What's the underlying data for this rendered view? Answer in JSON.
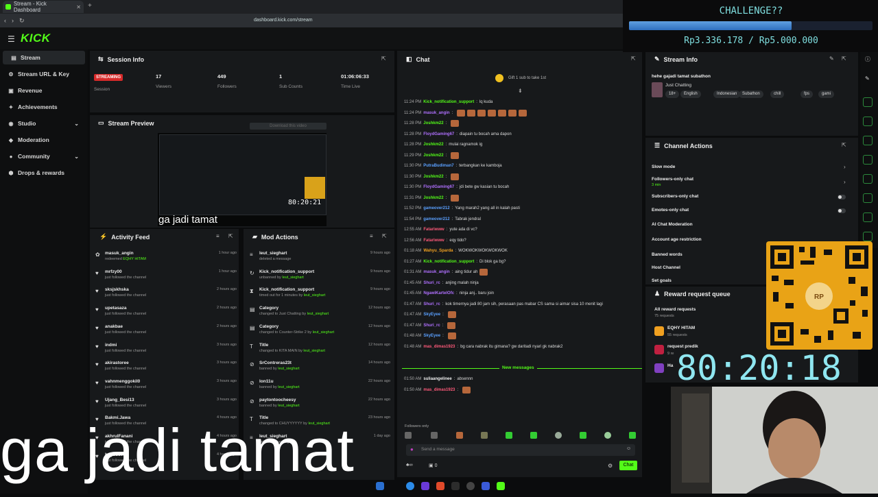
{
  "browser": {
    "tab_title": "Stream - Kick Dashboard",
    "url": "dashboard.kick.com/stream"
  },
  "header": {
    "logo": "KICK"
  },
  "sidebar": {
    "items": [
      {
        "label": "Stream"
      },
      {
        "label": "Stream URL & Key"
      },
      {
        "label": "Revenue"
      },
      {
        "label": "Achievements"
      },
      {
        "label": "Studio"
      },
      {
        "label": "Moderation"
      },
      {
        "label": "Community"
      },
      {
        "label": "Drops & rewards"
      }
    ]
  },
  "session": {
    "title": "Session Info",
    "badge": "STREAMING",
    "stats": [
      {
        "value": "",
        "label": "Session"
      },
      {
        "value": "17",
        "label": "Viewers"
      },
      {
        "value": "449",
        "label": "Followers"
      },
      {
        "value": "1",
        "label": "Sub Counts"
      },
      {
        "value": "01:06:06:33",
        "label": "Time Live"
      }
    ]
  },
  "preview": {
    "title": "Stream Preview",
    "download": "Download this video",
    "caption": "ga jadi tamat",
    "timer": "80:20:21"
  },
  "activity": {
    "title": "Activity Feed",
    "rows": [
      {
        "name": "masuk_angin",
        "sub": "redeemed ",
        "highlight": "EQHY HITAM",
        "time": "1 hour ago"
      },
      {
        "name": "mrfzy00",
        "sub": "just followed the channel",
        "highlight": "",
        "time": "1 hour ago"
      },
      {
        "name": "sksjskhska",
        "sub": "just followed the channel",
        "highlight": "",
        "time": "2 hours ago"
      },
      {
        "name": "upetasaza",
        "sub": "just followed the channel",
        "highlight": "",
        "time": "2 hours ago"
      },
      {
        "name": "anakbae",
        "sub": "just followed the channel",
        "highlight": "",
        "time": "2 hours ago"
      },
      {
        "name": "indmi",
        "sub": "just followed the channel",
        "highlight": "",
        "time": "3 hours ago"
      },
      {
        "name": "akirastoree",
        "sub": "just followed the channel",
        "highlight": "",
        "time": "3 hours ago"
      },
      {
        "name": "vahnmenggokil0",
        "sub": "just followed the channel",
        "highlight": "",
        "time": "3 hours ago"
      },
      {
        "name": "Ujang_Besi13",
        "sub": "just followed the channel",
        "highlight": "",
        "time": "3 hours ago"
      },
      {
        "name": "Bakmi.Jawa",
        "sub": "just followed the channel",
        "highlight": "",
        "time": "4 hours ago"
      },
      {
        "name": "akhrulFanani",
        "sub": "just followed the channel",
        "highlight": "",
        "time": "4 hours ago"
      },
      {
        "name": "boyo367",
        "sub": "just followed the channel",
        "highlight": "",
        "time": "4 hours ago"
      }
    ]
  },
  "mod": {
    "title": "Mod Actions",
    "rows": [
      {
        "icon": "≡",
        "name": "leut_sieghart",
        "sub": "deleted a message",
        "by": "",
        "time": "9 hours ago"
      },
      {
        "icon": "↻",
        "name": "Kick_notification_support",
        "sub": "unbanned by ",
        "by": "leut_sieghart",
        "time": "9 hours ago"
      },
      {
        "icon": "⧗",
        "name": "Kick_notification_support",
        "sub": "timed out for 1 minutes by ",
        "by": "leut_sieghart",
        "time": "9 hours ago"
      },
      {
        "icon": "▤",
        "name": "Category",
        "sub": "changed to Just Chatting by ",
        "by": "leut_sieghart",
        "time": "12 hours ago"
      },
      {
        "icon": "▤",
        "name": "Category",
        "sub": "changed to Counter-Strike 2 by ",
        "by": "leut_sieghart",
        "time": "12 hours ago"
      },
      {
        "icon": "T",
        "name": "Title",
        "sub": "changed to KITA MAIN by ",
        "by": "leut_sieghart",
        "time": "12 hours ago"
      },
      {
        "icon": "⊘",
        "name": "SrContreras23t",
        "sub": "banned by ",
        "by": "leut_sieghart",
        "time": "14 hours ago"
      },
      {
        "icon": "⊘",
        "name": "lon11u",
        "sub": "banned by ",
        "by": "leut_sieghart",
        "time": "22 hours ago"
      },
      {
        "icon": "⊘",
        "name": "paytontoocheesy",
        "sub": "banned by ",
        "by": "leut_sieghart",
        "time": "22 hours ago"
      },
      {
        "icon": "T",
        "name": "Title",
        "sub": "changed to CHUYYYYYY by ",
        "by": "leut_sieghart",
        "time": "23 hours ago"
      },
      {
        "icon": "≡",
        "name": "leut_sieghart",
        "sub": "deleted a message",
        "by": "",
        "time": "1 day ago"
      }
    ]
  },
  "chat": {
    "title": "Chat",
    "gift": "Gift 1 sub to take 1st",
    "new_messages": "New messages",
    "followers_only": "Followers only",
    "placeholder": "Send a message",
    "send": "Chat",
    "viewer_count": "0",
    "lines": [
      {
        "t": "11:24 PM",
        "u": "Kick_notification_support",
        "c": "#53fc18",
        "m": "lq kuda",
        "emotes": 0
      },
      {
        "t": "11:24 PM",
        "u": "masuk_angin",
        "c": "#b070ff",
        "m": "",
        "emotes": 7
      },
      {
        "t": "11:28 PM",
        "u": "Joshkm22",
        "c": "#53fc18",
        "m": "",
        "emotes": 1
      },
      {
        "t": "11:28 PM",
        "u": "FloydGaming67",
        "c": "#b070ff",
        "m": "diapain tu bocah ama dapon",
        "emotes": 0
      },
      {
        "t": "11:28 PM",
        "u": "Joshkm22",
        "c": "#53fc18",
        "m": "mulai ragnamok ig",
        "emotes": 0
      },
      {
        "t": "11:29 PM",
        "u": "Joshkm22",
        "c": "#53fc18",
        "m": "",
        "emotes": 1
      },
      {
        "t": "11:30 PM",
        "u": "PutraBudiman7",
        "c": "#5aa0ff",
        "m": "terbangkan ke kamboja",
        "emotes": 0
      },
      {
        "t": "11:30 PM",
        "u": "Joshkm22",
        "c": "#53fc18",
        "m": "",
        "emotes": 1
      },
      {
        "t": "11:30 PM",
        "u": "FloydGaming67",
        "c": "#b070ff",
        "m": "jdi bete gw kasian tu bocah",
        "emotes": 0
      },
      {
        "t": "11:31 PM",
        "u": "Joshkm22",
        "c": "#53fc18",
        "m": "",
        "emotes": 1
      },
      {
        "t": "11:52 PM",
        "u": "gameover212",
        "c": "#5aa0ff",
        "m": "Yang marah2 yang all in kalah pasti",
        "emotes": 0
      },
      {
        "t": "11:54 PM",
        "u": "gameover212",
        "c": "#5aa0ff",
        "m": "Tabrak jendral",
        "emotes": 0
      },
      {
        "t": "12:55 AM",
        "u": "Fatariwww",
        "c": "#ff5a7a",
        "m": "yute ada di vc?",
        "emotes": 0
      },
      {
        "t": "12:56 AM",
        "u": "Fatariwww",
        "c": "#ff5a7a",
        "m": "eqy tido?",
        "emotes": 0
      },
      {
        "t": "01:18 AM",
        "u": "Wahyu_Sparda",
        "c": "#f0a020",
        "m": "WOKWOKWOKWOKWOK",
        "emotes": 0
      },
      {
        "t": "01:27 AM",
        "u": "Kick_notification_support",
        "c": "#53fc18",
        "m": "Di blok ga bg?",
        "emotes": 0
      },
      {
        "t": "01:31 AM",
        "u": "masuk_angin",
        "c": "#b070ff",
        "m": "aing tidur ah",
        "emotes": 1
      },
      {
        "t": "01:45 AM",
        "u": "Shuri_rc",
        "c": "#b070ff",
        "m": "anjing malah ninja",
        "emotes": 0
      },
      {
        "t": "01:45 AM",
        "u": "NgawiKartelOfc",
        "c": "#b070ff",
        "m": "ninja anj.. baru join",
        "emotes": 0
      },
      {
        "t": "01:47 AM",
        "u": "Shuri_rc",
        "c": "#b070ff",
        "m": "kok timernya jadi 80 jam sih, perasaan pas mabar CS sama si aimar sisa 10 menit lagi",
        "emotes": 0
      },
      {
        "t": "01:47 AM",
        "u": "SkyEyee",
        "c": "#5aa0ff",
        "m": "",
        "emotes": 1
      },
      {
        "t": "01:47 AM",
        "u": "Shuri_rc",
        "c": "#b070ff",
        "m": "",
        "emotes": 1
      },
      {
        "t": "01:48 AM",
        "u": "SkyEyee",
        "c": "#5aa0ff",
        "m": "",
        "emotes": 1
      },
      {
        "t": "01:48 AM",
        "u": "mas_dimas1923",
        "c": "#ff5a7a",
        "m": "bg cara nabrak itu gimana? gw daritadi nyari gk nabrak2",
        "emotes": 0
      }
    ],
    "after": [
      {
        "t": "01:50 AM",
        "u": "suliaangelinee",
        "c": "#eee",
        "m": "absennn",
        "emotes": 0
      },
      {
        "t": "01:50 AM",
        "u": "mas_dimas1923",
        "c": "#ff5a7a",
        "m": "",
        "emotes": 1
      }
    ]
  },
  "stream_info": {
    "title": "Stream Info",
    "stream_title": "hehe gajadi tamat subathon",
    "category": "Just Chatting",
    "tags": [
      "18+",
      "English",
      "Indonesian",
      "Subathon",
      "chill",
      "fps",
      "gami"
    ]
  },
  "channel_actions": {
    "title": "Channel Actions",
    "rows": [
      {
        "label": "Slow mode",
        "sub": ""
      },
      {
        "label": "Followers-only chat",
        "sub": "3 min"
      },
      {
        "label": "Subscribers-only chat",
        "sub": ""
      },
      {
        "label": "Emotes-only chat",
        "sub": ""
      },
      {
        "label": "AI Chat Moderation",
        "sub": ""
      },
      {
        "label": "Account age restriction",
        "sub": ""
      },
      {
        "label": "Banned words",
        "sub": ""
      },
      {
        "label": "Host Channel",
        "sub": ""
      },
      {
        "label": "Set goals",
        "sub": ""
      }
    ]
  },
  "reward_queue": {
    "title": "Reward request queue",
    "all": "All reward requests",
    "all_count": "75 requests",
    "rows": [
      {
        "name": "EQHY HITAM",
        "count": "55 requests"
      },
      {
        "name": "request predik",
        "count": "9 re"
      },
      {
        "name": "Ha",
        "count": ""
      }
    ]
  },
  "overlay": {
    "challenge_title": "CHALLENGE??",
    "challenge_amount": "Rp3.336.178 / Rp5.000.000",
    "challenge_progress": 0.667,
    "timer": "80:20:18",
    "caption": "ga jadi tamat"
  },
  "colors": {
    "accent": "#53fc18",
    "panel": "#17191b",
    "bg": "#0b0c0d",
    "overlay_text": "#7fdfe0"
  }
}
